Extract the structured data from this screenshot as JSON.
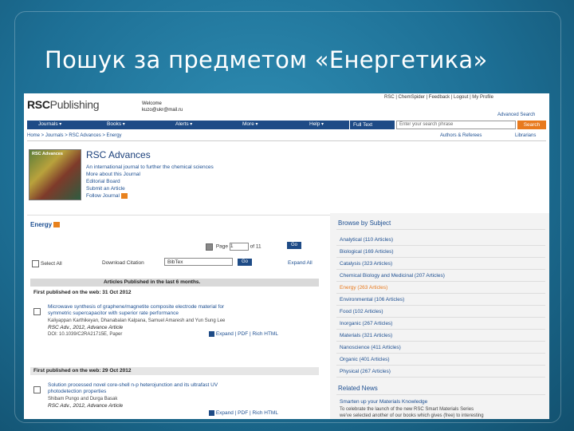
{
  "slide": {
    "title": "Пошук за предметом «Енергетика»"
  },
  "header": {
    "logo_main": "RSC",
    "logo_sub": "Publishing",
    "welcome_label": "Welcome",
    "welcome_user": "kuzo@ukr@mail.ru",
    "top_links": "RSC | ChemSpider | Feedback |   Logout | My Profile",
    "advanced_search": "Advanced Search"
  },
  "nav": {
    "items": [
      "Journals",
      "Books",
      "Alerts",
      "More",
      "Help"
    ],
    "search_type": "Full Text",
    "search_placeholder": "Enter your search phrase",
    "search_button": "Search"
  },
  "breadcrumb": "Home > Journals > RSC Advances > Energy",
  "utility_links": {
    "authors": "Authors & Referees",
    "librarians": "Librarians"
  },
  "journal": {
    "cover_label": "RSC Advances",
    "title": "RSC Advances",
    "links": [
      "An international journal to further the chemical sciences",
      "More about this Journal",
      "Editorial Board",
      "Submit an Article",
      "Follow Journal"
    ]
  },
  "section": {
    "title": "Energy"
  },
  "pager": {
    "page_label": "Page",
    "page_value": "1",
    "of_label": "of 11",
    "go_label": "Go"
  },
  "list_controls": {
    "select_all": "Select All",
    "download_citation": "Download Citation",
    "format": "BibTex",
    "go_label": "Go",
    "expand_all": "Expand All"
  },
  "articles_bar": "Articles Published in the last 6 months.",
  "groups": [
    {
      "published": "First published on the web: 31 Oct 2012",
      "title_line1": "Microwave synthesis of graphene/magnetite composite electrode material for",
      "title_line2": "symmetric supercapacitor with superior rate performance",
      "authors": "Kaliyappan Karthikeyan, Dhanabalan Kalpana, Samuel Amaresh and Yun Sung Lee",
      "journal": "RSC Adv., 2012, Advance Article",
      "doi": "DOI: 10.1039/C2RA21715E, Paper",
      "links": "Expand | PDF | Rich HTML"
    },
    {
      "published": "First published on the web: 29 Oct 2012",
      "title_line1": "Solution processed novel core-shell n-p heterojunction and its ultrafast UV",
      "title_line2": "photodetection properties",
      "authors": "Shibam Pungo and Durga Basak",
      "journal": "RSC Adv., 2012, Advance Article",
      "links": "Expand | PDF | Rich HTML"
    }
  ],
  "browse": {
    "title": "Browse by Subject",
    "subjects": [
      "Analytical (110 Articles)",
      "Biological (169 Articles)",
      "Catalysis (323 Articles)",
      "Chemical Biology and Medicinal (207 Articles)",
      "Energy (263 Articles)",
      "Environmental (106 Articles)",
      "Food (102 Articles)",
      "Inorganic (267 Articles)",
      "Materials (321 Articles)",
      "Nanoscience (411 Articles)",
      "Organic (401 Articles)",
      "Physical (267 Articles)"
    ],
    "active_index": 4
  },
  "related": {
    "title": "Related News",
    "headline": "Smarten up your Materials Knowledge",
    "body1": "To celebrate the launch of the new RSC Smart Materials Series",
    "body2": "we've selected another of our books which gives (free) to interesting"
  },
  "colors": {
    "nav_blue": "#1e4b86",
    "link_blue": "#1d4f91",
    "accent_orange": "#e87a1e"
  }
}
